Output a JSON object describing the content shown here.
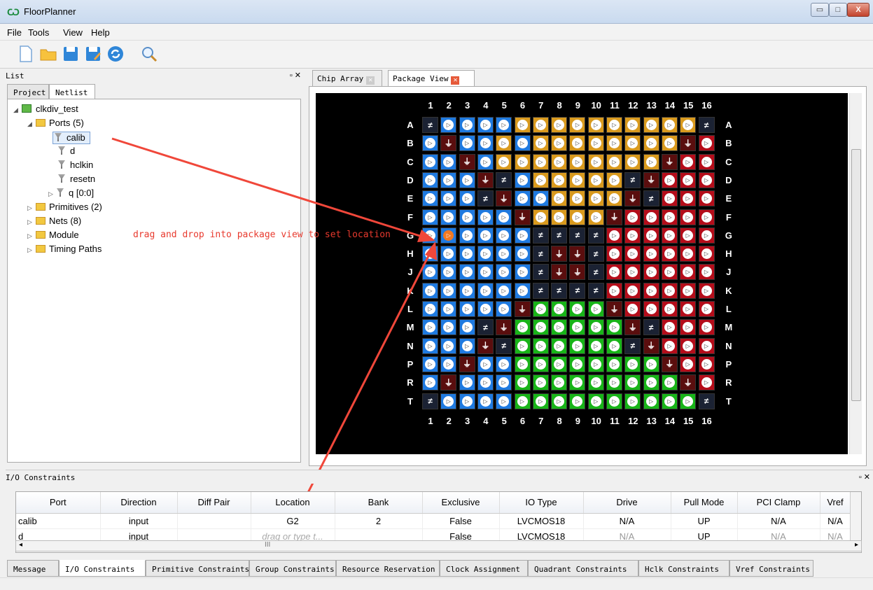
{
  "window": {
    "title": "FloorPlanner",
    "minimize": "▭",
    "maximize": "□",
    "close": "X"
  },
  "menu": [
    "File",
    "Tools",
    "View",
    "Help"
  ],
  "toolbar": [
    "new-file-icon",
    "open-folder-icon",
    "save-icon",
    "save-as-icon",
    "refresh-icon",
    "search-icon"
  ],
  "list_panel": {
    "title": "List",
    "tabs": [
      "Project",
      "Netlist"
    ],
    "active_tab": "Netlist",
    "tree": {
      "root": "clkdiv_test",
      "ports_label": "Ports (5)",
      "ports": [
        "calib",
        "d",
        "hclkin",
        "resetn",
        "q [0:0]"
      ],
      "folders": [
        "Primitives (2)",
        "Nets (8)",
        "Module",
        "Timing Paths"
      ]
    }
  },
  "view_tabs": [
    "Chip Array",
    "Package View"
  ],
  "active_view": "Package View",
  "package_view": {
    "columns": [
      "1",
      "2",
      "3",
      "4",
      "5",
      "6",
      "7",
      "8",
      "9",
      "10",
      "11",
      "12",
      "13",
      "14",
      "15",
      "16"
    ],
    "rows": [
      "A",
      "B",
      "C",
      "D",
      "E",
      "F",
      "G",
      "H",
      "J",
      "K",
      "L",
      "M",
      "N",
      "P",
      "R",
      "T"
    ],
    "bank_colors": {
      "Y": "#d99a1e",
      "B": "#1f7ae0",
      "R": "#b40d1a",
      "G": "#18b418",
      "N": "#1b2233",
      "M": "#5a0e0e"
    },
    "pin_map": [
      "NBBBBYYYYYYYYYYN",
      "BMBBYBYYYYYYYYMR",
      "BBMBYYYYYYYYYMRR",
      "BBBMNBYYYYYNMRRR",
      "BBBNMBBYYYYMNRRR",
      "BBBBBMYYYYMRRRRR",
      "BBBBBBNNNNRRRRRR",
      "BBBBBBNMMNRRRRRR",
      "BBBBBBNMMNRRRRRR",
      "BBBBBBNNNNRRRRRR",
      "BBBBBMGGGGMRRRRR",
      "BBBNMGGGGGGMNRRR",
      "BBBMNGGGGGGNMRRR",
      "BBMBBGGGGGGGGMRR",
      "BMBBBGGGGGGGGGMR",
      "NBBBBGGGGGGGGGGN"
    ],
    "selected_pin": "G2"
  },
  "drag_hint": "drag and drop into package view to set location",
  "io_constraints": {
    "title": "I/O Constraints",
    "columns": [
      "Port",
      "Direction",
      "Diff Pair",
      "Location",
      "Bank",
      "Exclusive",
      "IO Type",
      "Drive",
      "Pull Mode",
      "PCI Clamp",
      "Vref"
    ],
    "rows": [
      [
        "calib",
        "input",
        "",
        "G2",
        "2",
        "False",
        "LVCMOS18",
        "N/A",
        "UP",
        "N/A",
        "N/A"
      ],
      [
        "d",
        "input",
        "",
        "drag or type t...",
        "",
        "False",
        "LVCMOS18",
        "N/A",
        "UP",
        "N/A",
        "N/A"
      ]
    ],
    "scroll_marker": "III"
  },
  "bottom_tabs": [
    "Message",
    "I/O Constraints",
    "Primitive Constraints",
    "Group Constraints",
    "Resource Reservation",
    "Clock Assignment",
    "Quadrant Constraints",
    "Hclk Constraints",
    "Vref Constraints"
  ],
  "active_bottom_tab": "I/O Constraints"
}
